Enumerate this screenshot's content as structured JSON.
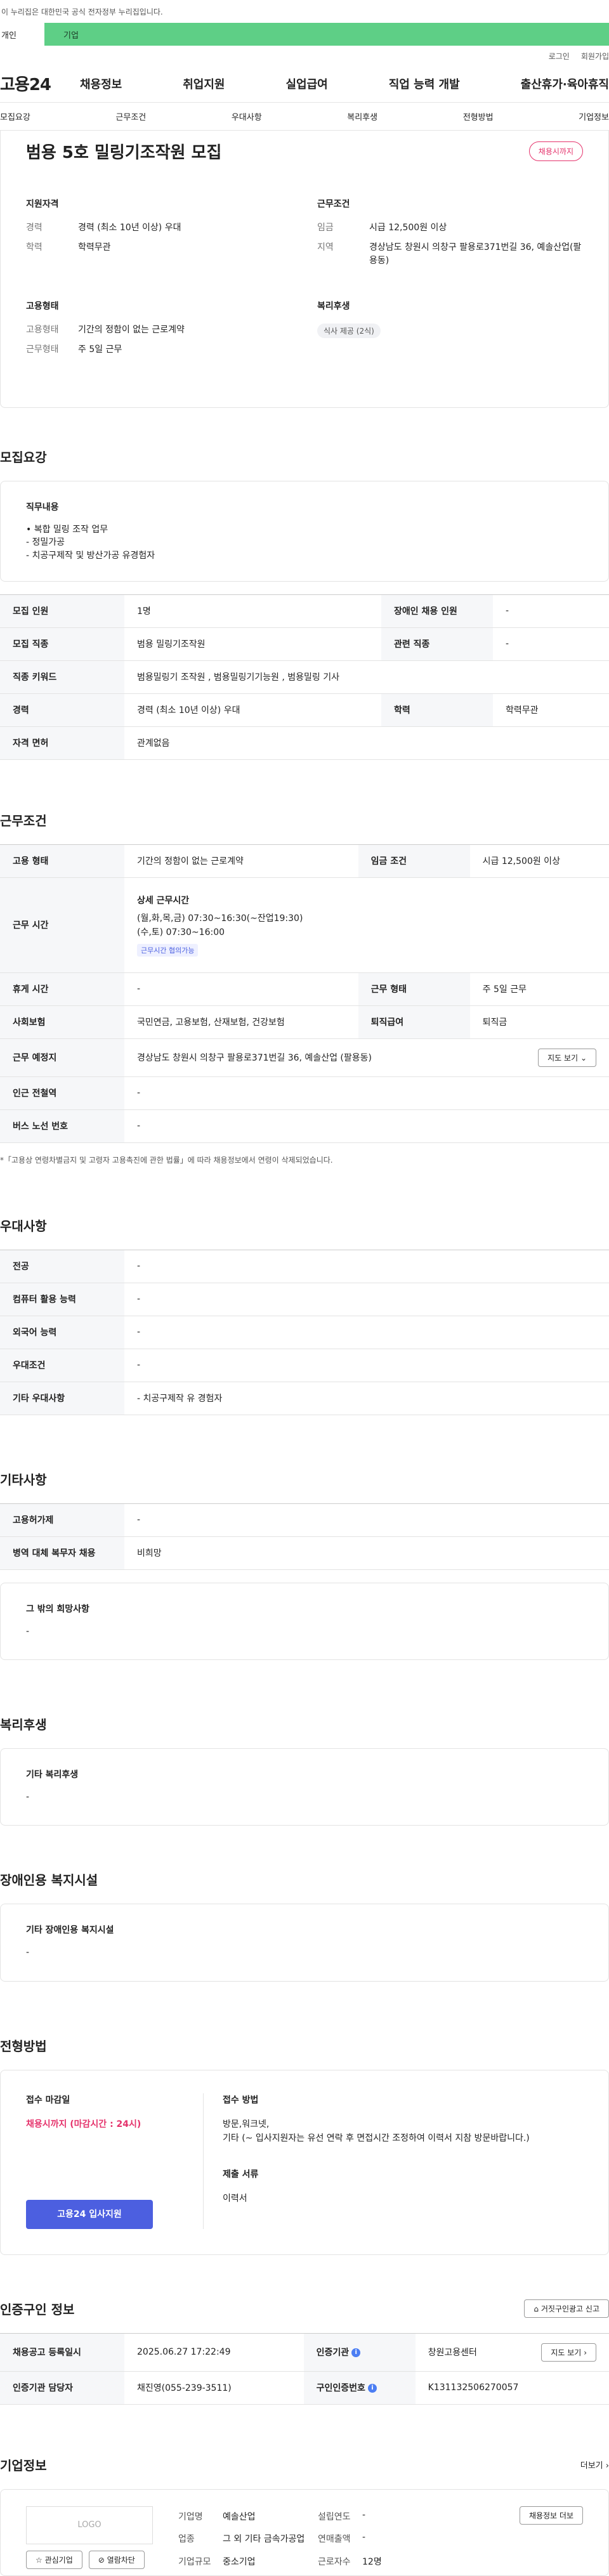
{
  "gov_banner": "이 누리집은 대한민국 공식 전자정부 누리집입니다.",
  "user_tabs": [
    "개인",
    "기업"
  ],
  "util": [
    "로그인",
    "회원가입"
  ],
  "logo": "고용24",
  "gnb": [
    "채용정보",
    "취업지원",
    "실업급여",
    "직업 능력 개발",
    "출산휴가·육아휴직"
  ],
  "subnav": [
    "모집요강",
    "근무조건",
    "우대사항",
    "복리후생",
    "전형방법",
    "기업정보"
  ],
  "title": "범용 5호 밀링기조작원 모집",
  "status_badge": "채용시까지",
  "summary": {
    "qual_title": "지원자격",
    "qual": [
      {
        "k": "경력",
        "v": "경력 (최소 10년 이상) 우대"
      },
      {
        "k": "학력",
        "v": "학력무관"
      }
    ],
    "cond_title": "근무조건",
    "cond": [
      {
        "k": "임금",
        "v": "시급 12,500원 이상"
      },
      {
        "k": "지역",
        "v": "경상남도 창원시 의창구 팔용로371번길 36, 예솔산업(팔용동)"
      }
    ],
    "emp_title": "고용형태",
    "emp": [
      {
        "k": "고용형태",
        "v": "기간의 정함이 없는 근로계약"
      },
      {
        "k": "근무형태",
        "v": "주 5일 근무"
      }
    ],
    "welfare_title": "복리후생",
    "welfare_chip": "식사 제공 (2식)"
  },
  "recruit": {
    "title": "모집요강",
    "duty_title": "직무내용",
    "duty_lines": [
      "• 복합 밀링 조작 업무",
      "- 정밀가공",
      "- 치공구제작 및 방산가공 유경험자"
    ],
    "rows": [
      [
        "모집 인원",
        "1명",
        "장애인 채용 인원",
        "-"
      ],
      [
        "모집 직종",
        "범용 밀링기조작원",
        "관련 직종",
        "-"
      ],
      [
        "직종 키워드",
        "범용밀링기 조작원 , 범용밀링기기능원 , 범용밀링 기사"
      ],
      [
        "경력",
        "경력 (최소 10년 이상) 우대",
        "학력",
        "학력무관"
      ],
      [
        "자격 면허",
        "관계없음"
      ]
    ]
  },
  "work": {
    "title": "근무조건",
    "emp_type_k": "고용 형태",
    "emp_type_v": "기간의 정함이 없는 근로계약",
    "wage_k": "임금 조건",
    "wage_v": "시급 12,500원 이상",
    "time_k": "근무 시간",
    "time_sub": "상세 근무시간",
    "time_lines": [
      "(월,화,목,금) 07:30~16:30(~잔업19:30)",
      "(수,토) 07:30~16:00"
    ],
    "time_tag": "근무시간 협의가능",
    "holiday_k": "휴게 시간",
    "holiday_v": "-",
    "form_k": "근무 형태",
    "form_v": "주 5일 근무",
    "ins_k": "사회보험",
    "ins_v": "국민연금, 고용보험, 산재보험, 건강보험",
    "sev_k": "퇴직급여",
    "sev_v": "퇴직금",
    "place_k": "근무 예정지",
    "place_v": "경상남도 창원시 의창구 팔용로371번길 36, 예솔산업 (팔용동)",
    "map_btn": "지도 보기",
    "station_k": "인근 전철역",
    "station_v": "-",
    "bus_k": "버스 노선 번호",
    "bus_v": "-",
    "note": "*「고용상 연령차별금지 및 고령자 고용촉진에 관한 법률」에 따라 채용정보에서 연령이 삭제되었습니다."
  },
  "pref": {
    "title": "우대사항",
    "rows": [
      [
        "전공",
        "-"
      ],
      [
        "컴퓨터 활용 능력",
        "-"
      ],
      [
        "외국어 능력",
        "-"
      ],
      [
        "우대조건",
        "-"
      ],
      [
        "기타 우대사항",
        "- 치공구제작 유 경험자"
      ]
    ]
  },
  "etc": {
    "title": "기타사항",
    "rows": [
      [
        "고용허가제",
        "-"
      ],
      [
        "병역 대체 복무자 채용",
        "비희망"
      ]
    ],
    "box_title": "그 밖의 희망사항",
    "box_value": "-"
  },
  "welfare": {
    "title": "복리후생",
    "box_title": "기타 복리후생",
    "box_value": "-"
  },
  "disabled": {
    "title": "장애인용 복지시설",
    "box_title": "기타 장애인용 복지시설",
    "box_value": "-"
  },
  "apply": {
    "title": "전형방법",
    "deadline_title": "접수 마감일",
    "deadline": "채용시까지 (마감시간 : 24시)",
    "apply_btn": "고용24 입사지원",
    "method_title": "접수 방법",
    "method_lines": [
      "방문,워크넷,",
      "기타 (~ 입사지원자는 유선 연락 후 면접시간 조정하여 이력서 지참 방문바랍니다.)"
    ],
    "docs_title": "제출 서류",
    "docs": "이력서"
  },
  "cert": {
    "title": "인증구인 정보",
    "report_btn": "거짓구인광고 신고",
    "row1": [
      "채용공고 등록일시",
      "2025.06.27 17:22:49",
      "인증기관",
      "창원고용센터"
    ],
    "view_btn": "지도 보기",
    "row2": [
      "인증기관 담당자",
      "채진영(055-239-3511)",
      "구인인증번호",
      "K131132506270057"
    ]
  },
  "company": {
    "title": "기업정보",
    "more": "더보기",
    "logo_text": "LOGO",
    "fav_btn": "관심기업",
    "block_btn": "열람차단",
    "fields": [
      [
        "기업명",
        "예솔산업",
        "설립연도",
        "-"
      ],
      [
        "업종",
        "그 외 기타 금속가공업",
        "연매출액",
        "-"
      ],
      [
        "기업규모",
        "중소기업",
        "근로자수",
        "12명"
      ]
    ],
    "jobs_btn": "채용정보 더보"
  }
}
